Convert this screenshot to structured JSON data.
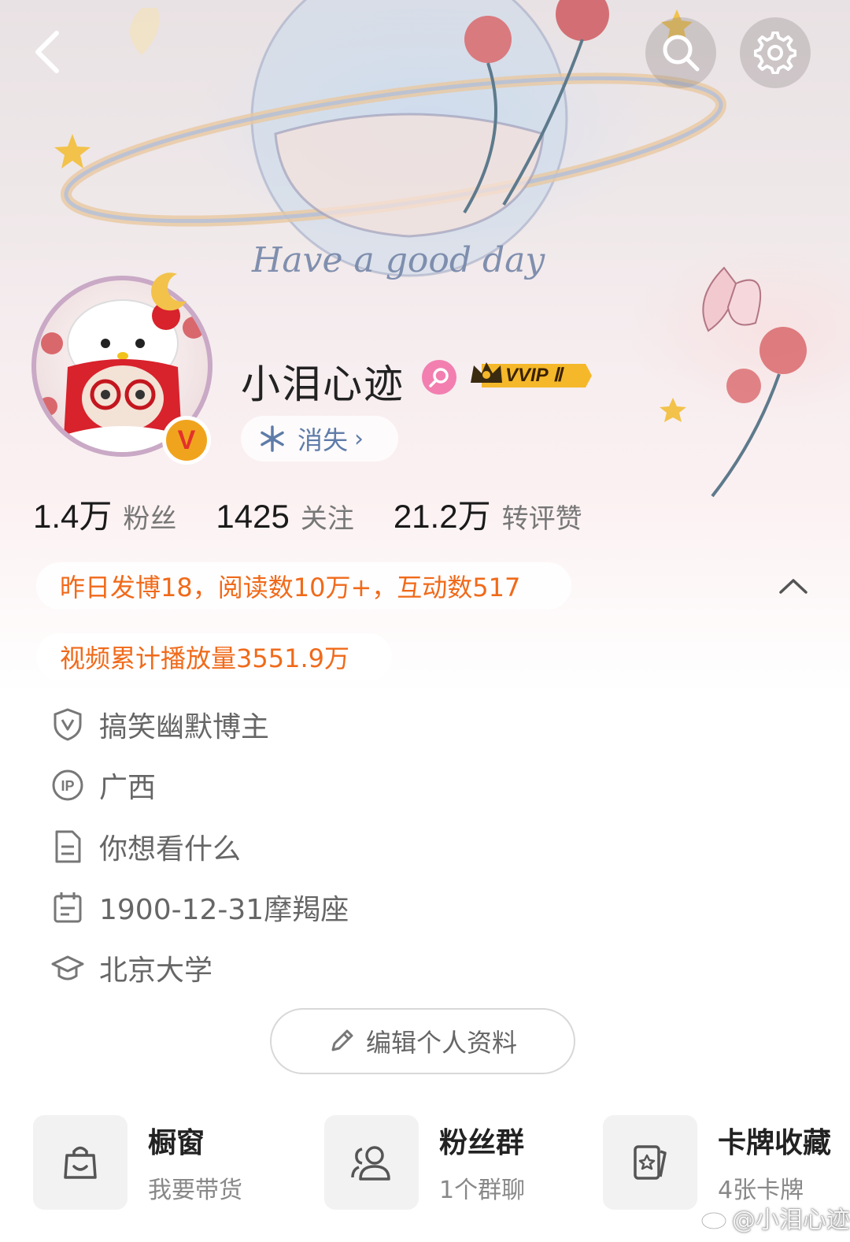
{
  "banner": {
    "tagline": "Have a good day"
  },
  "topbar": {
    "back_icon": "chevron-left-icon",
    "search_icon": "search-icon",
    "settings_icon": "gear-icon"
  },
  "profile": {
    "name": "小泪心迹",
    "gender": "female",
    "vip_badge": "VVIP Ⅱ",
    "verified_badge": "V",
    "status": {
      "label": "消失",
      "chevron": "›"
    }
  },
  "stats": [
    {
      "value": "1.4万",
      "label": "粉丝"
    },
    {
      "value": "1425",
      "label": "关注"
    },
    {
      "value": "21.2万",
      "label": "转评赞"
    }
  ],
  "highlights": {
    "line1": "昨日发博18，阅读数10万+，互动数517",
    "line2": "视频累计播放量3551.9万"
  },
  "details": [
    {
      "icon": "shield-v-icon",
      "text": "搞笑幽默博主"
    },
    {
      "icon": "ip-icon",
      "text": "广西"
    },
    {
      "icon": "document-icon",
      "text": "你想看什么"
    },
    {
      "icon": "calendar-icon",
      "text": "1900-12-31摩羯座"
    },
    {
      "icon": "graduation-cap-icon",
      "text": "北京大学"
    }
  ],
  "edit_button": {
    "label": "编辑个人资料"
  },
  "cards": [
    {
      "icon": "shopping-bag-icon",
      "title": "橱窗",
      "subtitle": "我要带货"
    },
    {
      "icon": "group-icon",
      "title": "粉丝群",
      "subtitle": "1个群聊"
    },
    {
      "icon": "card-collection-icon",
      "title": "卡牌收藏",
      "subtitle": "4张卡牌"
    }
  ],
  "watermark": "@小泪心迹",
  "colors": {
    "accent_orange": "#f06a1a",
    "status_blue": "#5e7ca8",
    "gender_pink": "#f27fb0",
    "badge_gold": "#f0a41e"
  }
}
